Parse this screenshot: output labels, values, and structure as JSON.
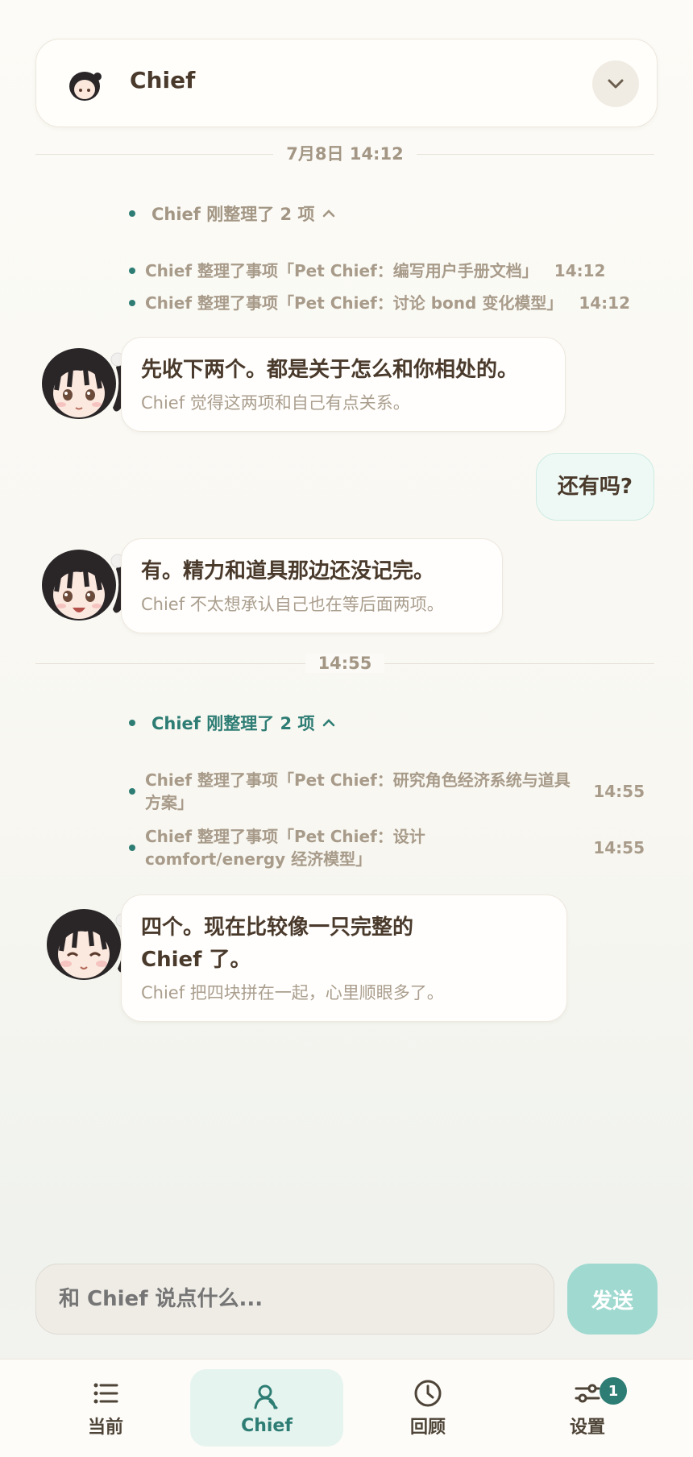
{
  "header": {
    "name": "Chief"
  },
  "dividers": [
    "7月8日 14:12",
    "14:55"
  ],
  "groups": [
    {
      "head": "Chief 刚整理了 2 项",
      "events": [
        {
          "text": "Chief 整理了事项「Pet Chief：编写用户手册文档」",
          "time": "14:12"
        },
        {
          "text": "Chief 整理了事项「Pet Chief：讨论 bond 变化模型」",
          "time": "14:12"
        }
      ]
    },
    {
      "head": "Chief 刚整理了 2 项",
      "events": [
        {
          "text": "Chief 整理了事项「Pet Chief：研究角色经济系统与道具方案」",
          "time": "14:55"
        },
        {
          "text": "Chief 整理了事项「Pet Chief：设计 comfort/energy 经济模型」",
          "time": "14:55"
        }
      ]
    }
  ],
  "messages": [
    {
      "main": "先收下两个。都是关于怎么和你相处的。",
      "sub": "Chief 觉得这两项和自己有点关系。"
    },
    {
      "user": "还有吗?"
    },
    {
      "main": "有。精力和道具那边还没记完。",
      "sub": "Chief 不太想承认自己也在等后面两项。"
    },
    {
      "main": "四个。现在比较像一只完整的 Chief 了。",
      "sub": "Chief 把四块拼在一起，心里顺眼多了。"
    }
  ],
  "composer": {
    "placeholder": "和 Chief 说点什么...",
    "send_label": "发送"
  },
  "tabs": [
    {
      "label": "当前",
      "icon": "list-icon"
    },
    {
      "label": "Chief",
      "icon": "person-icon"
    },
    {
      "label": "回顾",
      "icon": "clock-icon"
    },
    {
      "label": "设置",
      "icon": "sliders-icon",
      "badge": "1"
    }
  ],
  "colors": {
    "accent": "#2e7d74",
    "send": "#9fd9cf",
    "user_bubble": "#eef9f5"
  }
}
